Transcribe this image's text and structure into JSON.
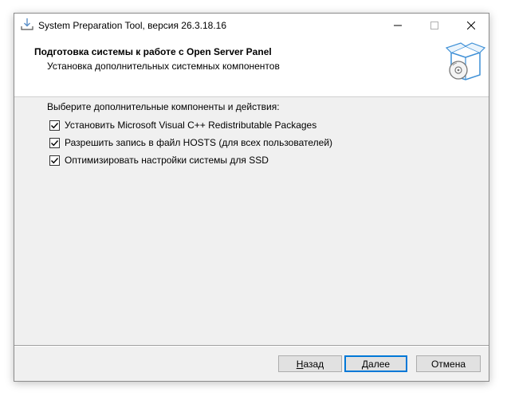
{
  "window": {
    "title": "System Preparation Tool, версия 26.3.18.16"
  },
  "header": {
    "title": "Подготовка системы к работе с Open Server Panel",
    "subtitle": "Установка дополнительных системных компонентов",
    "graphic_icon": "install-box-disc-icon"
  },
  "content": {
    "prompt": "Выберите дополнительные компоненты и действия:",
    "options": [
      {
        "label": "Установить Microsoft Visual C++ Redistributable Packages",
        "checked": true
      },
      {
        "label": "Разрешить запись в файл HOSTS (для всех пользователей)",
        "checked": true
      },
      {
        "label": "Оптимизировать настройки системы для SSD",
        "checked": true
      }
    ]
  },
  "footer": {
    "back_label": "Назад",
    "next_label": "Далее",
    "cancel_label": "Отмена"
  },
  "colors": {
    "accent": "#0078d7",
    "window_bg": "#f0f0f0",
    "header_bg": "#ffffff"
  }
}
